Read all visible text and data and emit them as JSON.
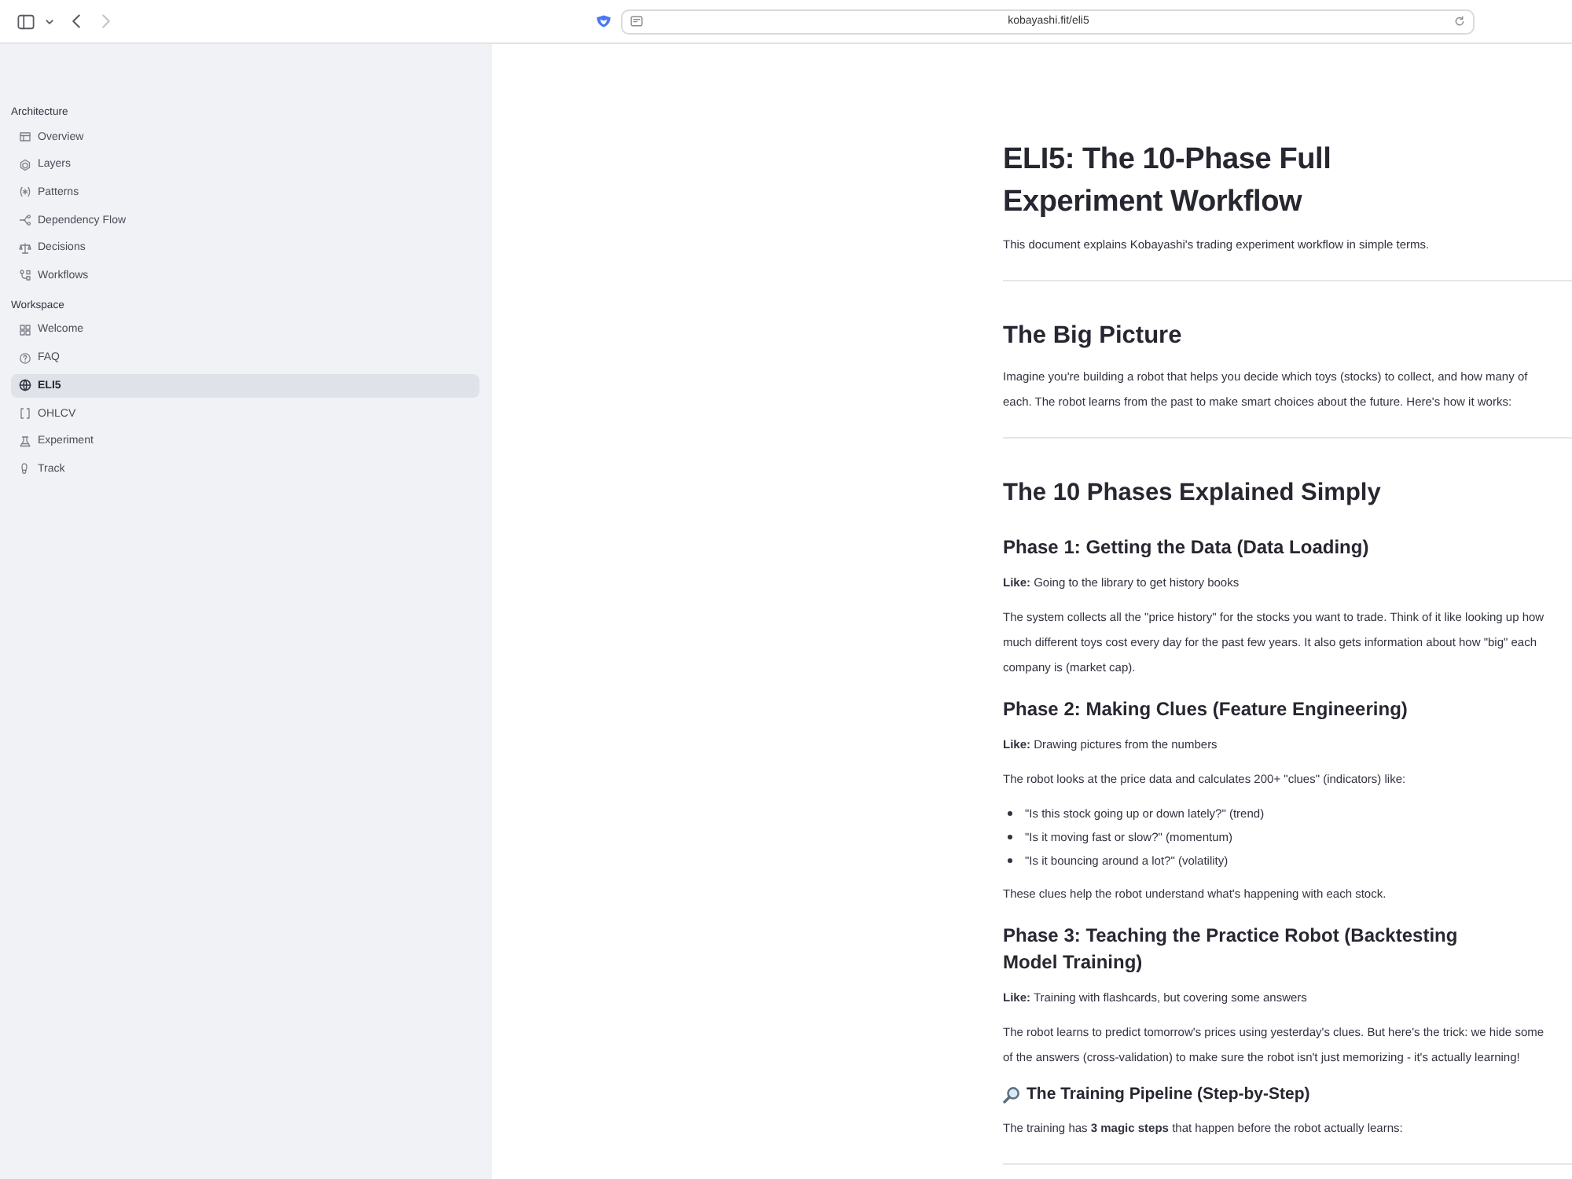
{
  "toolbar": {
    "back": {
      "disabled": false
    },
    "forward": {
      "disabled": true
    }
  },
  "address": {
    "url": "kobayashi.fit/eli5"
  },
  "sidebar": {
    "sections": [
      {
        "title": "Architecture",
        "items": [
          {
            "label": "Overview",
            "selected": false
          },
          {
            "label": "Layers",
            "selected": false
          },
          {
            "label": "Patterns",
            "selected": false
          },
          {
            "label": "Dependency Flow",
            "selected": false
          },
          {
            "label": "Decisions",
            "selected": false
          },
          {
            "label": "Workflows",
            "selected": false
          }
        ]
      },
      {
        "title": "Workspace",
        "items": [
          {
            "label": "Welcome",
            "selected": false
          },
          {
            "label": "FAQ",
            "selected": false
          },
          {
            "label": "ELI5",
            "selected": true
          },
          {
            "label": "OHLCV",
            "selected": false
          },
          {
            "label": "Experiment",
            "selected": false
          },
          {
            "label": "Track",
            "selected": false
          }
        ]
      }
    ]
  },
  "content": [
    {
      "kind": "h1",
      "text": "ELI5: The 10-Phase Full Experiment Workflow"
    },
    {
      "kind": "p",
      "text": "This document explains Kobayashi's trading experiment workflow in simple terms."
    },
    {
      "kind": "hr"
    },
    {
      "kind": "h2",
      "text": "The Big Picture"
    },
    {
      "kind": "p",
      "text": "Imagine you're building a robot that helps you decide which toys (stocks) to collect, and how many of each. The robot learns from the past to make smart choices about the future. Here's how it works:"
    },
    {
      "kind": "hr"
    },
    {
      "kind": "h2",
      "text": "The 10 Phases Explained Simply"
    },
    {
      "kind": "h3",
      "text": "Phase 1: Getting the Data (Data Loading)"
    },
    {
      "kind": "p",
      "text": "**Like:** Going to the library to get history books"
    },
    {
      "kind": "p",
      "text": "The system collects all the \"price history\" for the stocks you want to trade. Think of it like looking up how much different toys cost every day for the past few years. It also gets information about how \"big\" each company is (market cap)."
    },
    {
      "kind": "h3",
      "text": "Phase 2: Making Clues (Feature Engineering)"
    },
    {
      "kind": "p",
      "text": "**Like:** Drawing pictures from the numbers"
    },
    {
      "kind": "p",
      "text": "The robot looks at the price data and calculates 200+ \"clues\" (indicators) like:"
    },
    {
      "kind": "ul",
      "items": [
        "\"Is this stock going up or down lately?\" (trend)",
        "\"Is it moving fast or slow?\" (momentum)",
        "\"Is it bouncing around a lot?\" (volatility)"
      ]
    },
    {
      "kind": "p",
      "text": "These clues help the robot understand what's happening with each stock."
    },
    {
      "kind": "h3",
      "text": "Phase 3: Teaching the Practice Robot (Backtesting Model Training)"
    },
    {
      "kind": "p",
      "text": "**Like:** Training with flashcards, but covering some answers"
    },
    {
      "kind": "p",
      "text": "The robot learns to predict tomorrow's prices using yesterday's clues. But here's the trick: we hide some of the answers (cross-validation) to make sure the robot isn't just memorizing - it's actually learning!"
    },
    {
      "kind": "h4",
      "icon": true,
      "text": "The Training Pipeline (Step-by-Step)"
    },
    {
      "kind": "p",
      "text": "The training has **3 magic steps** that happen before the robot actually learns:"
    },
    {
      "kind": "hr"
    }
  ]
}
